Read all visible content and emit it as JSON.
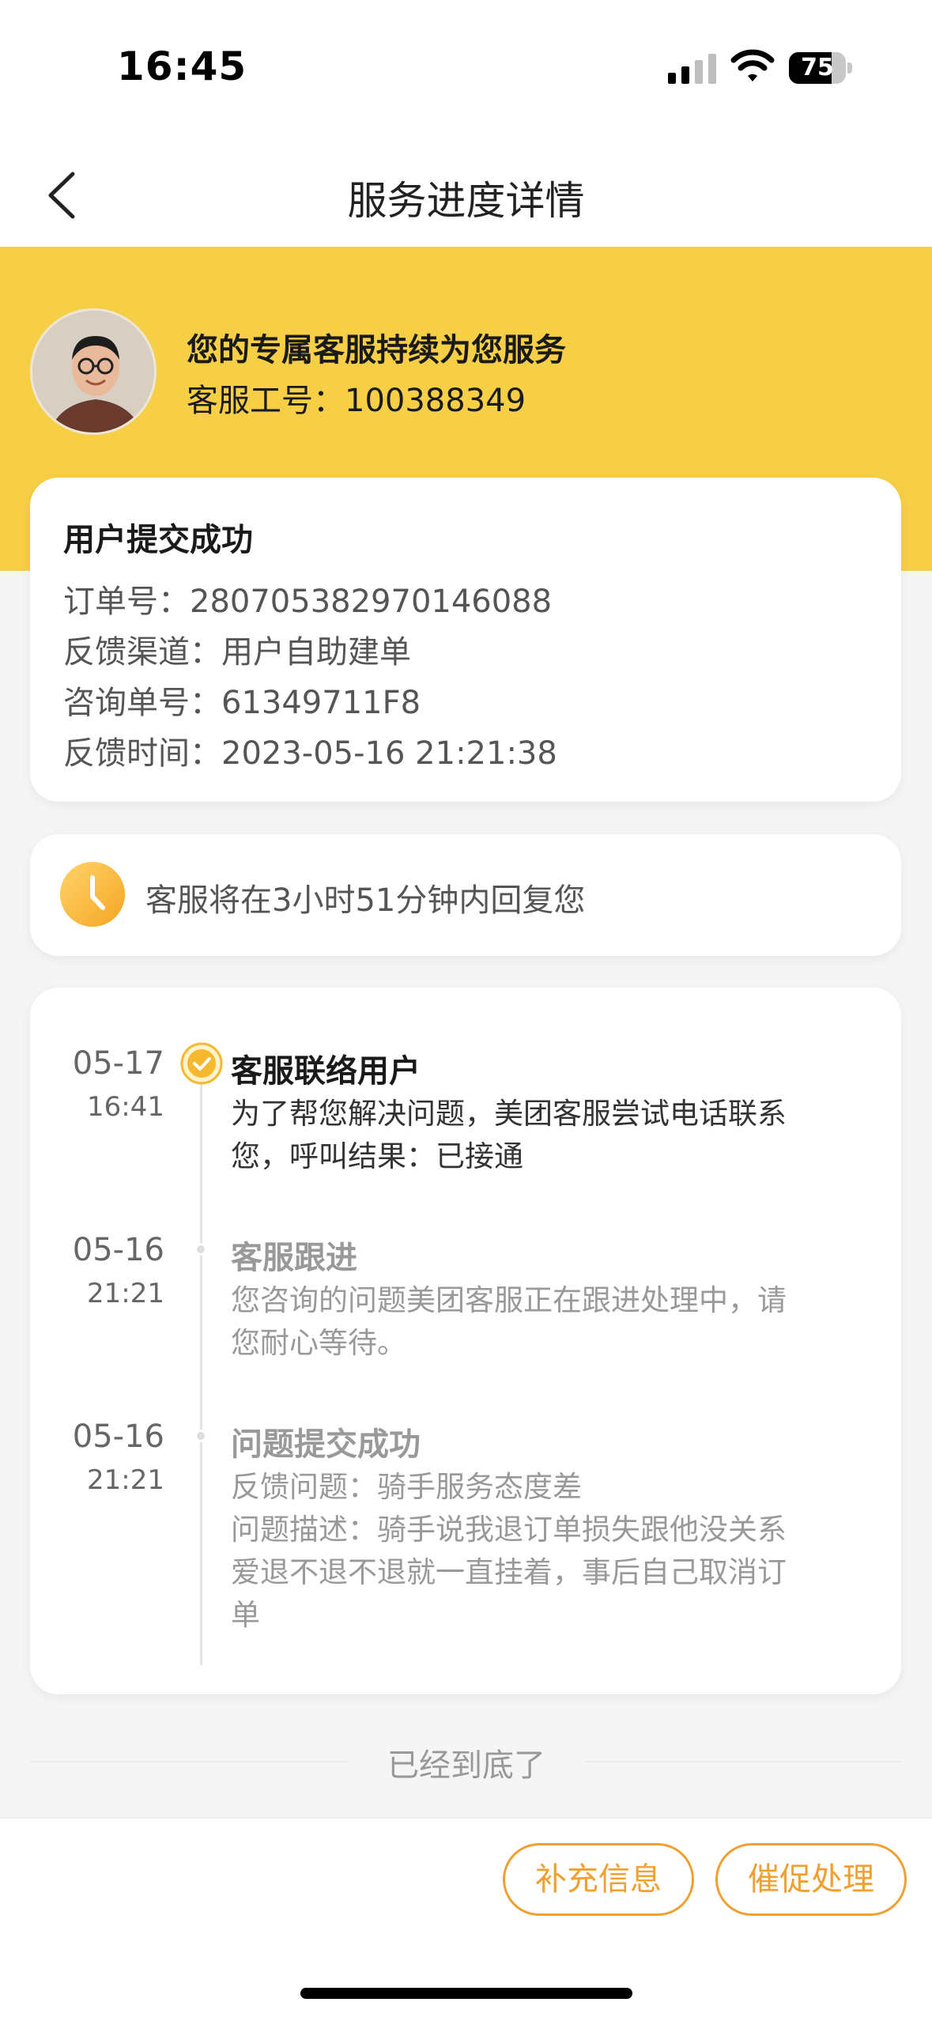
{
  "status_bar": {
    "time": "16:45",
    "battery_percent": 75,
    "battery_label": "75"
  },
  "nav": {
    "title": "服务进度详情"
  },
  "agent": {
    "title": "您的专属客服持续为您服务",
    "id_line": "客服工号：100388349"
  },
  "submission": {
    "title": "用户提交成功",
    "rows": [
      "订单号：2807053829701460​88",
      "反馈渠道：用户自助建单",
      "咨询单号：61349711F8",
      "反馈时间：2023-05-16 21:21:38"
    ]
  },
  "reply_notice": {
    "text": "客服将在3小时51分钟内回复您"
  },
  "timeline": [
    {
      "date": "05-17",
      "time": "16:41",
      "title": "客服联络用户",
      "body": [
        "为了帮您解决问题，美团客服尝试电话联系",
        "您，呼叫结果：已接通"
      ],
      "active": true
    },
    {
      "date": "05-16",
      "time": "21:21",
      "title": "客服跟进",
      "body": [
        "您咨询的问题美团客服正在跟进处理中，请",
        "您耐心等待。"
      ],
      "active": false
    },
    {
      "date": "05-16",
      "time": "21:21",
      "title": "问题提交成功",
      "body": [
        "反馈问题：骑手服务态度差",
        "问题描述：骑手说我退订单损失跟他没关系",
        "爱退不退不退就一直挂着，事后自己取消订",
        "单"
      ],
      "active": false
    }
  ],
  "end_text": "已经到底了",
  "buttons": {
    "supplement": "补充信息",
    "urge": "催促处理"
  },
  "colors": {
    "header_yellow": "#f7cf46",
    "accent_orange": "#f0a030"
  }
}
